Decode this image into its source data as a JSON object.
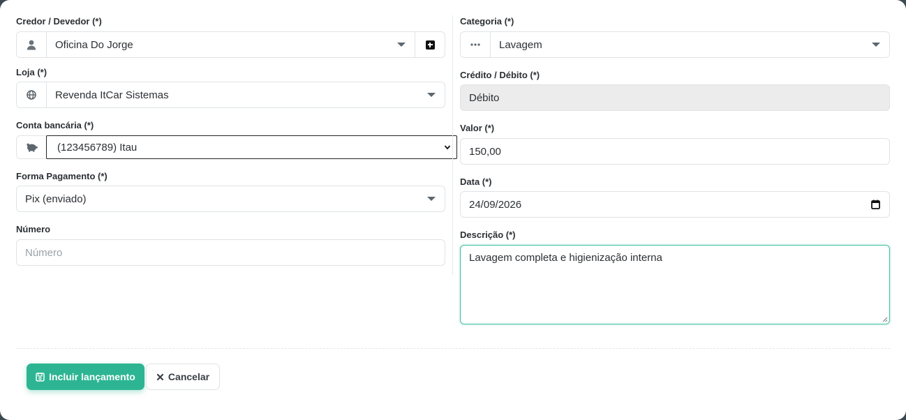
{
  "left": {
    "credor": {
      "label": "Credor / Devedor (*)",
      "value": "Oficina Do Jorge",
      "icon": "user-icon",
      "add_icon": "plus-square-icon"
    },
    "loja": {
      "label": "Loja (*)",
      "value": "Revenda ItCar Sistemas",
      "icon": "globe-icon"
    },
    "conta": {
      "label": "Conta bancária (*)",
      "value": "(123456789) Itau",
      "icon": "piggy-bank-icon"
    },
    "forma": {
      "label": "Forma Pagamento (*)",
      "value": "Pix (enviado)"
    },
    "numero": {
      "label": "Número",
      "placeholder": "Número"
    }
  },
  "right": {
    "categoria": {
      "label": "Categoria (*)",
      "value": "Lavagem",
      "icon": "ellipsis-icon"
    },
    "credito": {
      "label": "Crédito / Débito (*)",
      "value": "Débito"
    },
    "valor": {
      "label": "Valor (*)",
      "value": "150,00"
    },
    "data": {
      "label": "Data (*)",
      "value": "24/09/2026",
      "icon": "calendar-icon"
    },
    "descricao": {
      "label": "Descrição (*)",
      "value": "Lavagem completa e higienização interna"
    }
  },
  "actions": {
    "submit": {
      "label": "Incluir lançamento",
      "icon": "save-icon"
    },
    "cancel": {
      "label": "Cancelar",
      "icon": "close-icon"
    }
  },
  "colors": {
    "primary": "#2db593",
    "focus_border": "#3bbfa0",
    "disabled_bg": "#ececec"
  }
}
